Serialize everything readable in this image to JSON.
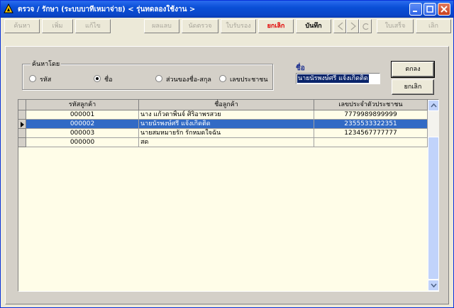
{
  "window": {
    "title": "ตรวจ / รักษา (ระบบบาทีเหมาจ่าย) < รุ่นทดลองใช้งาน >",
    "colors": {
      "titlebar": "#0a46c8",
      "selection": "#316ac5",
      "grid_bg": "#fffde8"
    }
  },
  "toolbar": [
    {
      "label": "ค้นหา",
      "state": "disabled"
    },
    {
      "label": "เพิ่ม",
      "state": "disabled"
    },
    {
      "label": "แก้ไข",
      "state": "disabled"
    },
    {
      "label": "ผลแลบ",
      "state": "disabled"
    },
    {
      "label": "นัดตรวจ",
      "state": "disabled"
    },
    {
      "label": "ใบรับรอง",
      "state": "disabled"
    },
    {
      "label": "ยกเลิก",
      "state": "active-red"
    },
    {
      "label": "บันทึก",
      "state": "active"
    },
    {
      "label": "ใบเสร็จ",
      "state": "disabled"
    },
    {
      "label": "เลิก",
      "state": "disabled"
    }
  ],
  "search": {
    "group_label": "ค้นหาโดย",
    "options": [
      {
        "label": "รหัส",
        "checked": false
      },
      {
        "label": "ชื่อ",
        "checked": true
      },
      {
        "label": "ส่วนของชื่อ-สกุล",
        "checked": false
      },
      {
        "label": "เลขประชาชน",
        "checked": false
      }
    ],
    "name_label": "ชื่อ",
    "name_value": "นายนัรพงษ์ศรี แจ้งเกิดติด",
    "ok_label": "ตกลง",
    "cancel_label": "ยกเลิก"
  },
  "grid": {
    "columns": [
      "รหัสลูกค้า",
      "ชื่อลูกค้า",
      "เลขประจำตัวประชาชน"
    ],
    "rows": [
      {
        "code": "000001",
        "name": "นาง แก้วตาพิ้นจ์ ศิริอาพรสวย",
        "id_number": "7779989899999",
        "selected": false
      },
      {
        "code": "000002",
        "name": "นายนัรพงษ์ศรี แจ้งเกิดติด",
        "id_number": "2355533322351",
        "selected": true
      },
      {
        "code": "000003",
        "name": "นายสมหมายรัก รักหมดใจฉัน",
        "id_number": "1234567777777",
        "selected": false
      },
      {
        "code": "000000",
        "name": "สด",
        "id_number": "",
        "selected": false
      }
    ]
  }
}
